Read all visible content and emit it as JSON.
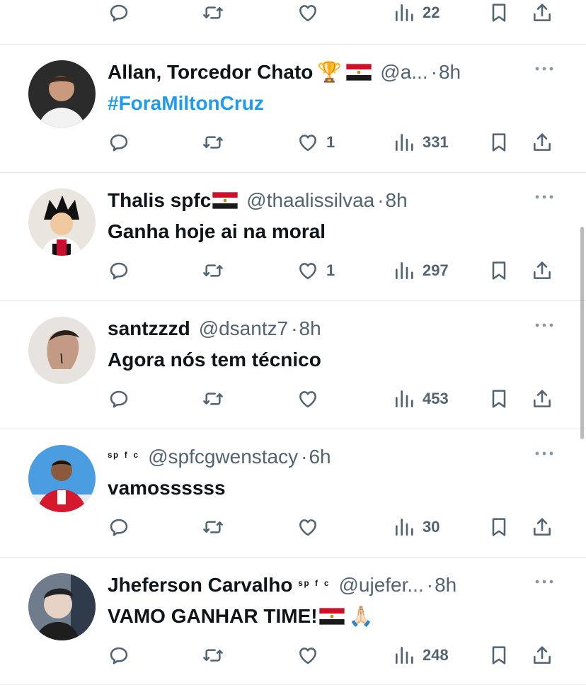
{
  "top_partial": {
    "views": "22"
  },
  "posts": [
    {
      "name": "Allan, Torcedor Chato",
      "handle": "@a...",
      "time": "8h",
      "text": "#ForaMiltonCruz",
      "likes": "1",
      "views": "331"
    },
    {
      "name": "Thalis spfc",
      "handle": "@thaalissilvaa",
      "time": "8h",
      "text": "Ganha hoje ai na moral",
      "likes": "1",
      "views": "297"
    },
    {
      "name": "santzzzd",
      "handle": "@dsantz7",
      "time": "8h",
      "text": "Agora nós tem técnico",
      "likes": "",
      "views": "453"
    },
    {
      "name": "ˢᵖ ᶠ ᶜ",
      "handle": "@spfcgwenstacy",
      "time": "6h",
      "text": "vamossssss",
      "likes": "",
      "views": "30"
    },
    {
      "name": "Jheferson Carvalho",
      "name_suffix": "ˢᵖ ᶠ ᶜ",
      "handle": "@ujefer...",
      "time": "8h",
      "text": "VAMO GANHAR TIME!",
      "likes": "",
      "views": "248"
    }
  ],
  "separator": "·",
  "icons": [
    "reply-icon",
    "retweet-icon",
    "like-icon",
    "views-icon",
    "bookmark-icon",
    "share-icon",
    "more-icon"
  ],
  "colors": {
    "link": "#1d9bf0",
    "muted": "#536471",
    "text": "#0f1419"
  }
}
